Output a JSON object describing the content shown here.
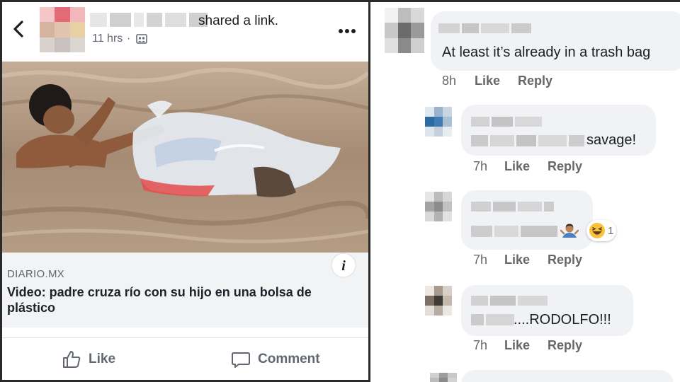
{
  "post": {
    "shared_text": "shared a link.",
    "time": "11 hrs",
    "separator": "·",
    "link": {
      "domain": "DIARIO.MX",
      "title": "Video: padre cruza río con su hijo en una bolsa de plástico"
    },
    "actions": {
      "like_label": "Like",
      "comment_label": "Comment"
    }
  },
  "icons": {
    "back": "chevron-left-icon",
    "audience": "friends-icon",
    "more": "more-dots-icon",
    "info": "info-icon",
    "like": "thumbs-up-icon",
    "comment": "comment-bubble-icon",
    "shrug": "person-shrugging-emoji",
    "haha": "haha-reaction-icon"
  },
  "comments": [
    {
      "text": "At least it’s already in a trash bag",
      "time": "8h",
      "like": "Like",
      "reply": "Reply"
    },
    {
      "text": "savage!",
      "time": "7h",
      "like": "Like",
      "reply": "Reply"
    },
    {
      "text": "",
      "time": "7h",
      "like": "Like",
      "reply": "Reply",
      "reaction_count": "1"
    },
    {
      "text": "....RODOLFO!!!",
      "time": "7h",
      "like": "Like",
      "reply": "Reply"
    }
  ],
  "colors": {
    "link_bg": "#f2f3f5",
    "bubble_bg": "#f0f2f5",
    "meta_text": "#65676b",
    "water": "#a48a72"
  }
}
